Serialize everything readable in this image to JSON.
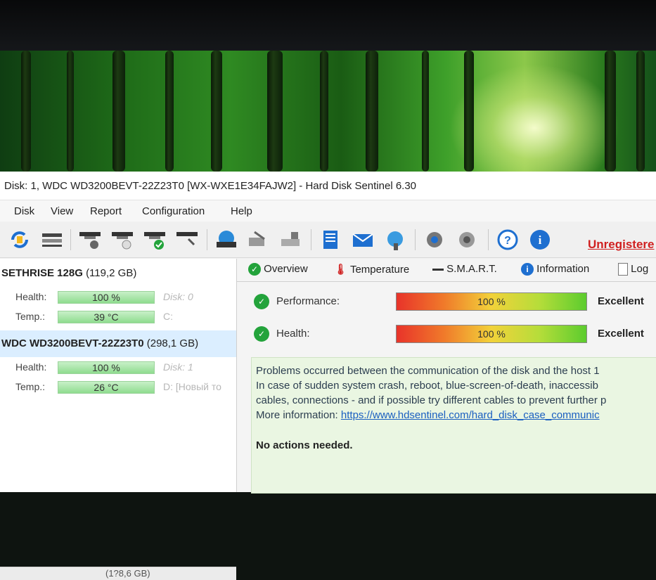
{
  "window": {
    "title": "Disk: 1, WDC WD3200BEVT-22Z23T0 [WX-WXE1E34FAJW2]  -  Hard Disk Sentinel 6.30"
  },
  "menu": [
    "Disk",
    "View",
    "Report",
    "Configuration",
    "Help"
  ],
  "toolbar": {
    "unregistered_label": "Unregistere"
  },
  "disks": [
    {
      "name": "SETHRISE 128G",
      "size": "(119,2 GB)",
      "health_label": "Health:",
      "health_value": "100 %",
      "health_fraction": 1.0,
      "temp_label": "Temp.:",
      "temp_value": "39 °C",
      "disk_index": "Disk: 0",
      "drive_letter": "C:"
    },
    {
      "name": "WDC WD3200BEVT-22Z23T0",
      "size": "(298,1 GB)",
      "health_label": "Health:",
      "health_value": "100 %",
      "health_fraction": 1.0,
      "temp_label": "Temp.:",
      "temp_value": "26 °C",
      "disk_index": "Disk: 1",
      "drive_letter": "D: [Новый то"
    }
  ],
  "bottom_partial_text": "(1?8,6 GB)",
  "tabs": [
    {
      "label": "Overview",
      "icon": "check-icon"
    },
    {
      "label": "Temperature",
      "icon": "thermometer-icon"
    },
    {
      "label": "S.M.A.R.T.",
      "icon": "dash-icon"
    },
    {
      "label": "Information",
      "icon": "info-icon"
    },
    {
      "label": "Log",
      "icon": "document-icon"
    }
  ],
  "overview": {
    "performance_label": "Performance:",
    "performance_value": "100 %",
    "performance_verdict": "Excellent",
    "health_label": "Health:",
    "health_value": "100 %",
    "health_verdict": "Excellent",
    "message_lines": [
      "Problems occurred between the communication of the disk and the host 1",
      "In case of sudden system crash, reboot, blue-screen-of-death, inaccessib",
      "cables, connections - and if possible try different cables to prevent further p"
    ],
    "more_info_label": "More information:",
    "more_info_link": "https://www.hdsentinel.com/hard_disk_case_communic",
    "actions": "No actions needed."
  },
  "colors": {
    "accent_green": "#23a33b",
    "unregistered_red": "#d02020",
    "selection_blue": "#dbeeff"
  }
}
